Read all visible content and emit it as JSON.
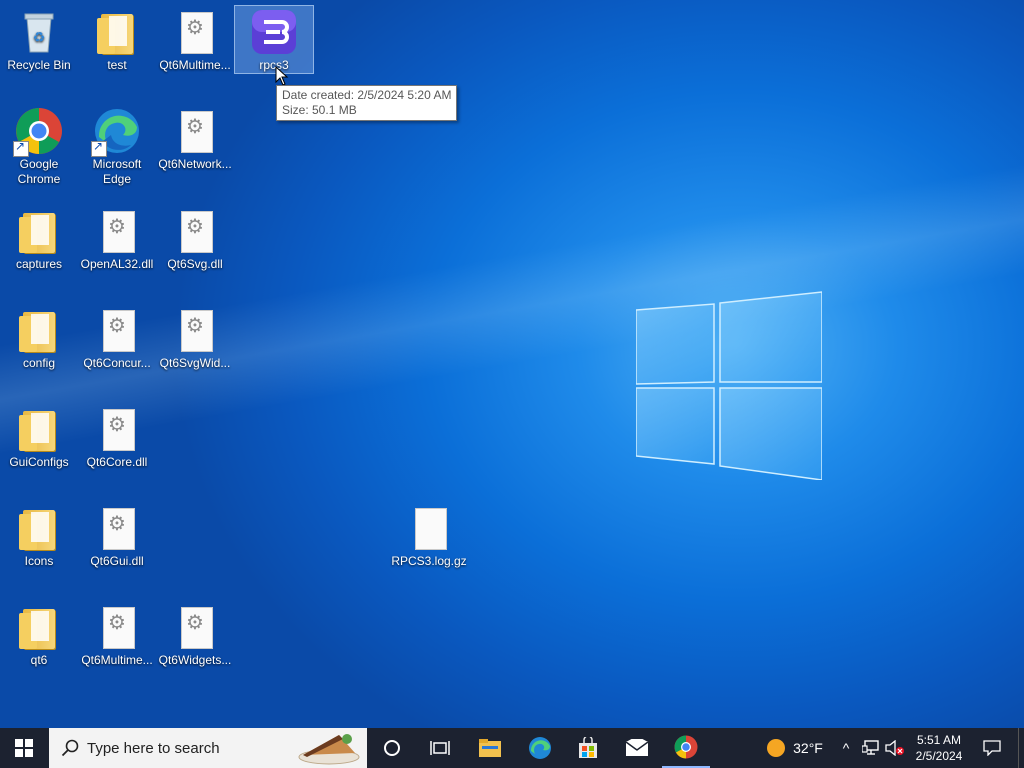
{
  "desktop": {
    "icons": [
      {
        "label": "Recycle Bin"
      },
      {
        "label": "test"
      },
      {
        "label": "Qt6Multime..."
      },
      {
        "label": "rpcs3"
      },
      {
        "label": "Google Chrome"
      },
      {
        "label": "Microsoft Edge"
      },
      {
        "label": "Qt6Network..."
      },
      {
        "label": "captures"
      },
      {
        "label": "OpenAL32.dll"
      },
      {
        "label": "Qt6Svg.dll"
      },
      {
        "label": "config"
      },
      {
        "label": "Qt6Concur..."
      },
      {
        "label": "Qt6SvgWid..."
      },
      {
        "label": "GuiConfigs"
      },
      {
        "label": "Qt6Core.dll"
      },
      {
        "label": "Icons"
      },
      {
        "label": "Qt6Gui.dll"
      },
      {
        "label": "RPCS3.log.gz"
      },
      {
        "label": "qt6"
      },
      {
        "label": "Qt6Multime..."
      },
      {
        "label": "Qt6Widgets..."
      }
    ],
    "tooltip": {
      "line1": "Date created: 2/5/2024 5:20 AM",
      "line2": "Size: 50.1 MB"
    }
  },
  "taskbar": {
    "search_placeholder": "Type here to search",
    "weather": "32°F",
    "time": "5:51 AM",
    "date": "2/5/2024",
    "pinned": [
      "cortana-icon",
      "task-view-icon",
      "file-explorer-icon",
      "edge-icon",
      "store-icon",
      "mail-icon",
      "chrome-icon"
    ]
  },
  "colors": {
    "taskbar": "#1c2230",
    "desktop_accent": "#0b6fd8",
    "rpcs3_brand": "#5b3fd6"
  }
}
